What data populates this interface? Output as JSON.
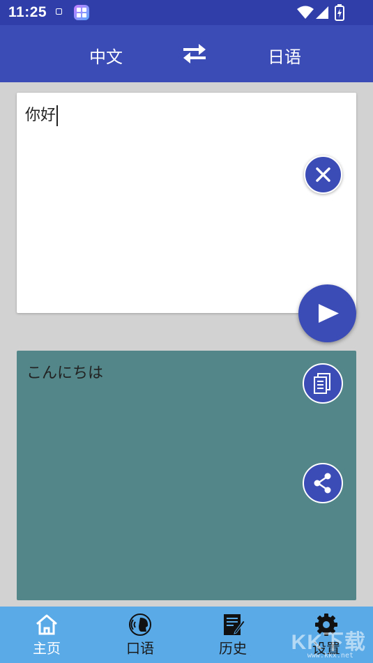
{
  "status_bar": {
    "time": "11:25"
  },
  "header": {
    "source_language": "中文",
    "target_language": "日语"
  },
  "input": {
    "text": "你好"
  },
  "output": {
    "text": "こんにちは"
  },
  "bottom_nav": {
    "items": [
      {
        "label": "主页",
        "icon": "home-icon"
      },
      {
        "label": "口语",
        "icon": "speak-icon"
      },
      {
        "label": "历史",
        "icon": "history-icon"
      },
      {
        "label": "设置",
        "icon": "gear-icon"
      }
    ]
  },
  "watermark": {
    "text": "KK下载",
    "url": "www.kkx.net"
  },
  "colors": {
    "primary": "#3c4cb7",
    "status_bar": "#2f3ea8",
    "output_bg": "#538688",
    "nav_bg": "#5aaae8",
    "background": "#d2d2d2"
  }
}
